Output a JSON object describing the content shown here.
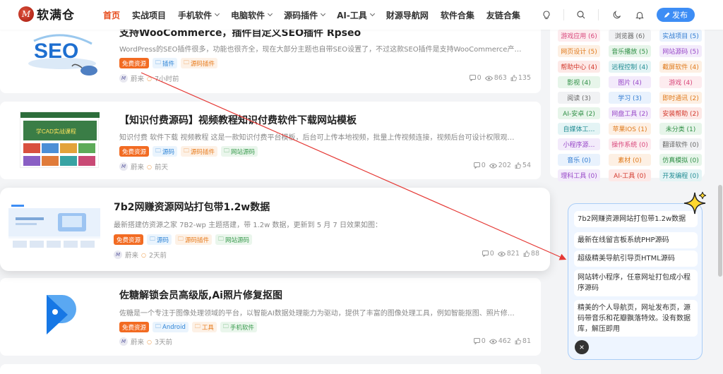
{
  "header": {
    "logo_mark": "M",
    "logo_text": "软满仓",
    "nav": [
      {
        "label": "首页",
        "active": true,
        "dropdown": false
      },
      {
        "label": "实战项目",
        "dropdown": false
      },
      {
        "label": "手机软件",
        "dropdown": true
      },
      {
        "label": "电脑软件",
        "dropdown": true
      },
      {
        "label": "源码插件",
        "dropdown": true
      },
      {
        "label": "AI-工具",
        "dropdown": true
      },
      {
        "label": "财源导航网",
        "dropdown": false
      },
      {
        "label": "软件合集",
        "dropdown": false
      },
      {
        "label": "友链合集",
        "dropdown": false
      }
    ],
    "icons": [
      "lightbulb-icon",
      "search-icon",
      "moon-icon",
      "bell-icon"
    ],
    "publish_label": "发布"
  },
  "posts": [
    {
      "title": "支持WooCommerce，插件自定义SEO插件 Rpseo",
      "desc": "WordPress的SEO插件很多，功能也很齐全，现在大部分主题也自带SEO设置了，不过这款SEO插件是支持WooCommerce产…",
      "tags": [
        {
          "label": "免费资源",
          "style": "free"
        },
        {
          "label": "插件",
          "style": "blue"
        },
        {
          "label": "源码插件",
          "style": "orange"
        }
      ],
      "author": "蔚来",
      "time": "7小时前",
      "comments": "0",
      "views": "863",
      "likes": "135",
      "thumb": "SEO"
    },
    {
      "title": "【知识付费源码】视频教程知识付费软件下载网站模板",
      "desc": "知识付费 软件下载 视频教程 这是一款知识付费平台模板，后台可上传本地视频，批量上传视频连接，视频后台可设计权限观…",
      "tags": [
        {
          "label": "免费资源",
          "style": "free"
        },
        {
          "label": "源码",
          "style": "blue"
        },
        {
          "label": "源码插件",
          "style": "orange"
        },
        {
          "label": "网站源码",
          "style": "green"
        }
      ],
      "author": "蔚来",
      "time": "前天",
      "comments": "0",
      "views": "202",
      "likes": "54",
      "thumb": "学CAD实战课程"
    },
    {
      "title": "7b2网赚资源网站打包带1.2w数据",
      "desc": "最新搭建仿资源之家 7B2-wp 主题搭建，带 1.2w 数据，更新到 5 月 7 日效果如图：",
      "tags": [
        {
          "label": "免费资源",
          "style": "free"
        },
        {
          "label": "源码",
          "style": "blue"
        },
        {
          "label": "源码插件",
          "style": "orange"
        },
        {
          "label": "网站源码",
          "style": "green"
        }
      ],
      "author": "蔚来",
      "time": "2天前",
      "comments": "0",
      "views": "821",
      "likes": "88"
    },
    {
      "title": "佐糖解锁会员高级版,Ai照片修复抠图",
      "desc": "佐糖是一个专注于图像处理领域的平台，以智能AI数据处理能力为驱动，提供了丰富的图像处理工具，例如智能抠图、照片修…",
      "tags": [
        {
          "label": "免费资源",
          "style": "free"
        },
        {
          "label": "Android",
          "style": "blue"
        },
        {
          "label": "工具",
          "style": "orange"
        },
        {
          "label": "手机软件",
          "style": "green"
        }
      ],
      "author": "蔚来",
      "time": "3天前",
      "comments": "0",
      "views": "462",
      "likes": "81"
    }
  ],
  "tag_cloud": [
    {
      "label": "游戏应用 (6)",
      "color": "pink"
    },
    {
      "label": "浏览器 (6)",
      "color": "gray"
    },
    {
      "label": "实战项目 (5)",
      "color": "blue"
    },
    {
      "label": "网页设计 (5)",
      "color": "orange"
    },
    {
      "label": "音乐播放 (5)",
      "color": "green"
    },
    {
      "label": "网站源码 (5)",
      "color": "purple"
    },
    {
      "label": "帮助中心 (4)",
      "color": "red"
    },
    {
      "label": "远程控制 (4)",
      "color": "teal"
    },
    {
      "label": "截屏软件 (4)",
      "color": "orange"
    },
    {
      "label": "影视 (4)",
      "color": "green"
    },
    {
      "label": "图片 (4)",
      "color": "purple"
    },
    {
      "label": "游戏 (4)",
      "color": "pink"
    },
    {
      "label": "阅读 (3)",
      "color": "gray"
    },
    {
      "label": "学习 (3)",
      "color": "blue"
    },
    {
      "label": "即时通讯 (2)",
      "color": "orange"
    },
    {
      "label": "AI-安卓 (2)",
      "color": "green"
    },
    {
      "label": "网盘工具 (2)",
      "color": "purple"
    },
    {
      "label": "安装帮助 (2)",
      "color": "red"
    },
    {
      "label": "自媒体工…",
      "color": "teal"
    },
    {
      "label": "苹果IOS (1)",
      "color": "orange"
    },
    {
      "label": "未分类 (1)",
      "color": "green"
    },
    {
      "label": "小程序源…",
      "color": "purple"
    },
    {
      "label": "操作系统 (0)",
      "color": "pink"
    },
    {
      "label": "翻译软件 (0)",
      "color": "gray"
    },
    {
      "label": "音乐 (0)",
      "color": "blue"
    },
    {
      "label": "素材 (0)",
      "color": "orange"
    },
    {
      "label": "仿真模拟 (0)",
      "color": "green"
    },
    {
      "label": "理科工具 (0)",
      "color": "purple"
    },
    {
      "label": "AI-工具 (0)",
      "color": "red"
    },
    {
      "label": "开发编程 (0)",
      "color": "teal"
    }
  ],
  "panel": {
    "items": [
      "7b2网赚资源网站打包带1.2w数据",
      "最新在线留言板系统PHP源码",
      "超级精美导航引导页HTML源码",
      "网站转小程序，任意网址打包成小程序源码",
      "精美的个人导航页，网址发布页，源码带音乐和花瓣飘落特效。没有数据库，解压即用"
    ],
    "close_label": "×"
  },
  "colors": {
    "accent": "#e64a19",
    "primary": "#3d8df5",
    "arrow": "#e53935"
  }
}
